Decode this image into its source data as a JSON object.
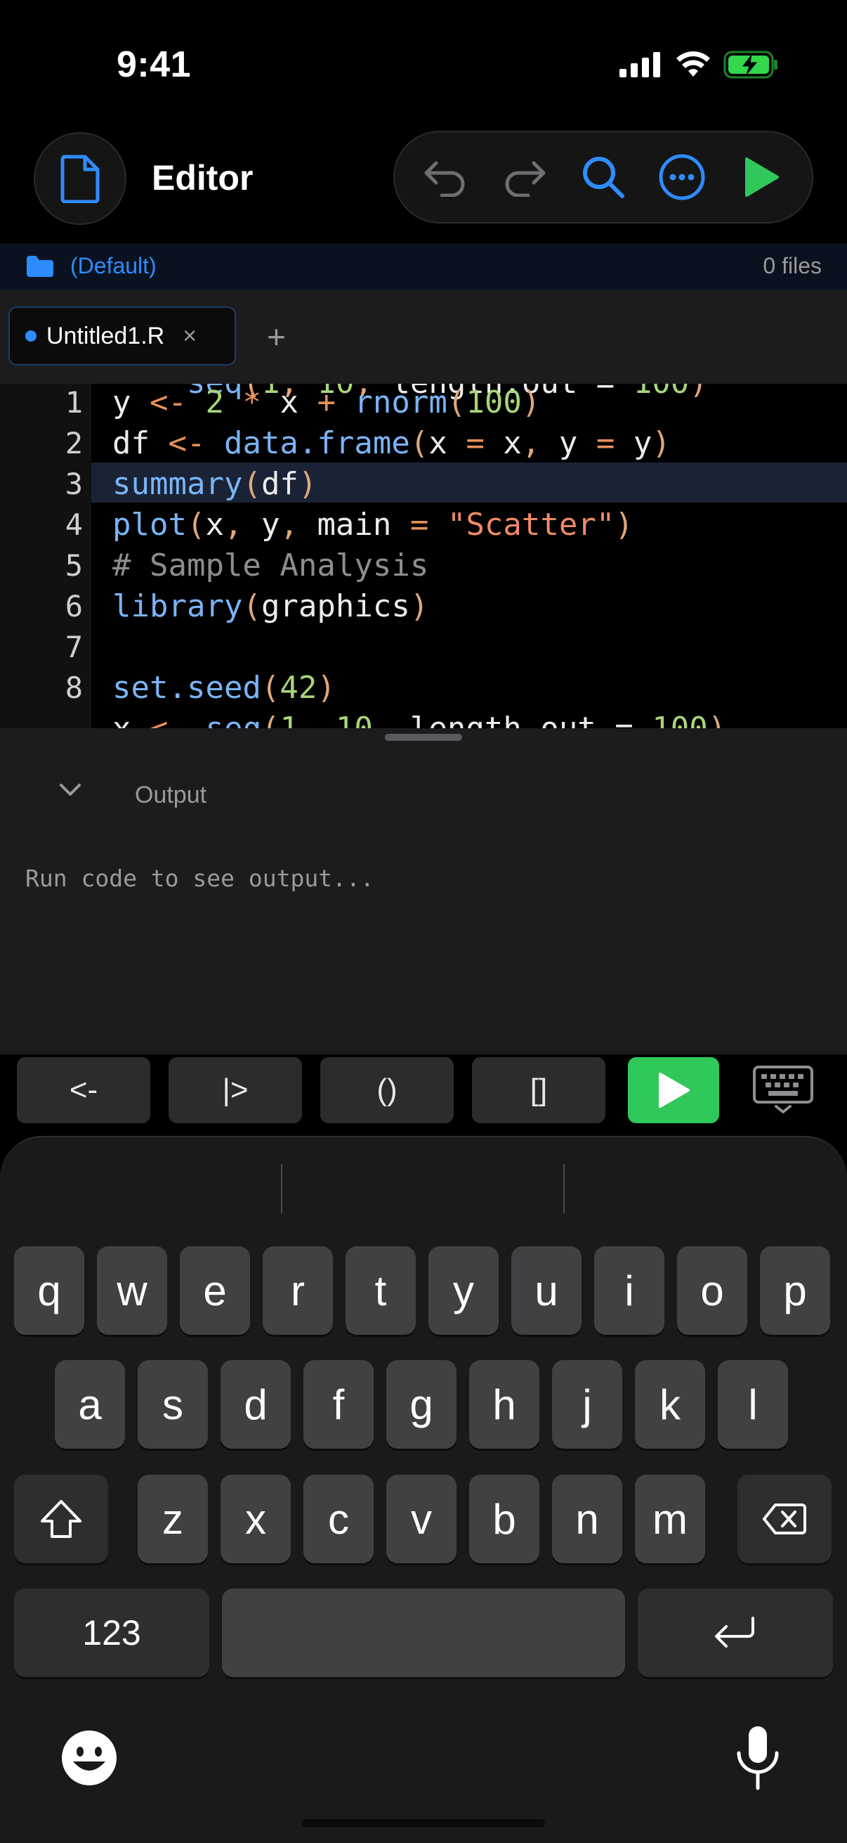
{
  "status_bar": {
    "time": "9:41"
  },
  "header": {
    "title": "Editor"
  },
  "toolbar": {
    "undo": "undo-icon",
    "redo": "redo-icon",
    "search": "search-icon",
    "more": "more-icon",
    "run": "play-icon",
    "accent": "#2f8cff",
    "run_color": "#30c85a"
  },
  "project": {
    "name": "(Default)",
    "file_count": "0 files"
  },
  "tabs": [
    {
      "label": "Untitled1.R",
      "close": "×"
    }
  ],
  "tab_add": "+",
  "editor": {
    "line_numbers": [
      "1",
      "2",
      "3",
      "4",
      "5",
      "6",
      "7",
      "8"
    ],
    "lines": [
      "y <- 2 * x + rnorm(100)",
      "df <- data.frame(x = x, y = y)",
      "summary(df)",
      "plot(x, y, main = \"Scatter\")",
      "# Sample Analysis",
      "library(graphics)",
      "",
      "set.seed(42)"
    ],
    "highlighted_line": 3
  },
  "output": {
    "title": "Output",
    "placeholder": "Run code to see output..."
  },
  "accessory": {
    "assign": "<-",
    "pipe": "|>",
    "parens": "()",
    "brackets": "[]"
  },
  "keyboard": {
    "row1": [
      "q",
      "w",
      "e",
      "r",
      "t",
      "y",
      "u",
      "i",
      "o",
      "p"
    ],
    "row2": [
      "a",
      "s",
      "d",
      "f",
      "g",
      "h",
      "j",
      "k",
      "l"
    ],
    "row3": [
      "z",
      "x",
      "c",
      "v",
      "b",
      "n",
      "m"
    ],
    "numbers": "123"
  }
}
